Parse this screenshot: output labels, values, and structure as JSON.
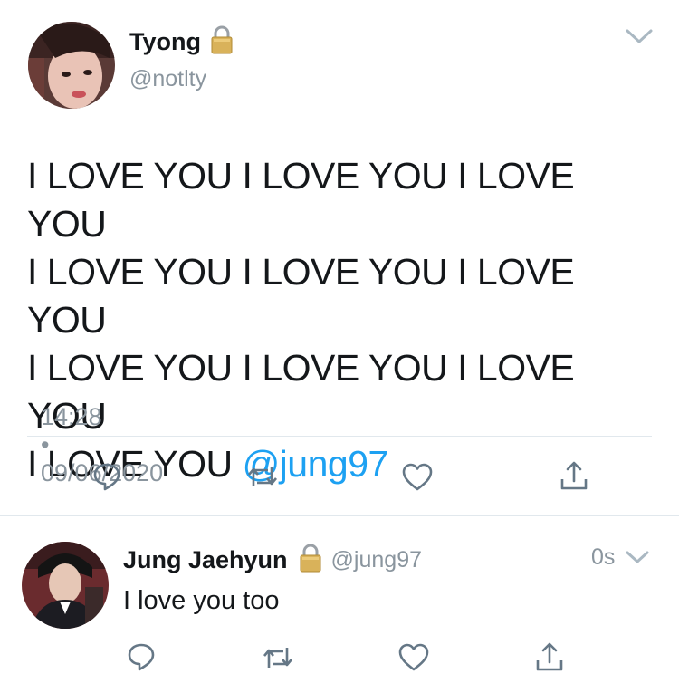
{
  "main_tweet": {
    "display_name": "Tyong",
    "handle": "@notlty",
    "text_lines": [
      "I LOVE YOU I LOVE YOU I LOVE YOU",
      "I LOVE YOU I LOVE YOU I LOVE YOU",
      "I LOVE YOU I LOVE YOU I LOVE YOU",
      "I LOVE YOU "
    ],
    "mention": "@jung97",
    "time": "14:28",
    "separator": "•",
    "date": "09/06/2020"
  },
  "reply": {
    "display_name": "Jung Jaehyun",
    "handle": "@jung97",
    "time_ago": "0s",
    "text": "I love you too"
  },
  "icons": {
    "reply": "speech-bubble-icon",
    "retweet": "retweet-icon",
    "like": "heart-icon",
    "share": "share-icon",
    "lock": "lock-icon",
    "menu": "chevron-down-icon"
  },
  "colors": {
    "link": "#1da1f2",
    "secondary_text": "#8a959e",
    "icon": "#657786",
    "divider": "#e1e8ed"
  }
}
